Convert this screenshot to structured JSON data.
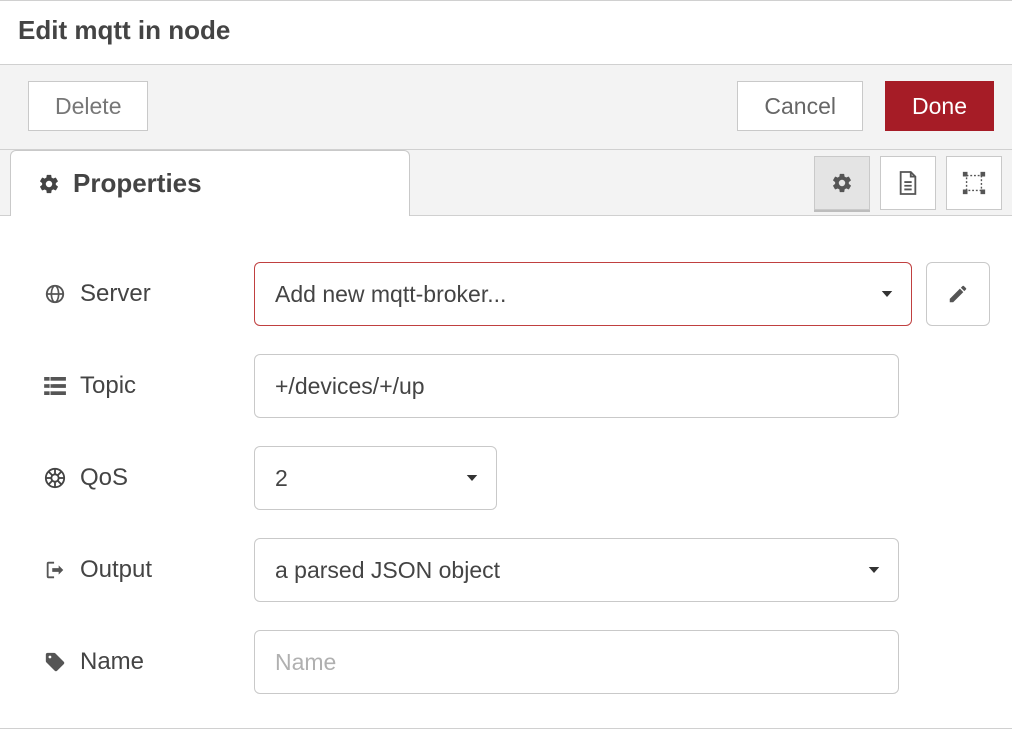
{
  "header": {
    "title": "Edit mqtt in node"
  },
  "toolbar": {
    "delete_label": "Delete",
    "cancel_label": "Cancel",
    "done_label": "Done"
  },
  "tabs": {
    "properties_label": "Properties"
  },
  "form": {
    "server": {
      "label": "Server",
      "value": "Add new mqtt-broker..."
    },
    "topic": {
      "label": "Topic",
      "value": "+/devices/+/up"
    },
    "qos": {
      "label": "QoS",
      "value": "2"
    },
    "output": {
      "label": "Output",
      "value": "a parsed JSON object"
    },
    "name": {
      "label": "Name",
      "placeholder": "Name",
      "value": ""
    }
  }
}
